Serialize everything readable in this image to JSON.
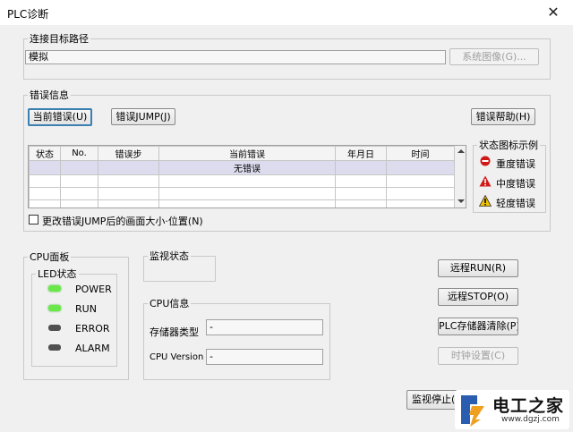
{
  "window": {
    "title": "PLC诊断",
    "close_glyph": "✕"
  },
  "connection": {
    "group_label": "连接目标路径",
    "target_value": "模拟",
    "system_image_button": "系统图像(G)..."
  },
  "error_info": {
    "group_label": "错误信息",
    "current_error_button": "当前错误(U)",
    "error_jump_button": "错误JUMP(J)",
    "error_help_button": "错误帮助(H)",
    "columns": [
      "状态",
      "No.",
      "错误步",
      "当前错误",
      "年月日",
      "时间"
    ],
    "rows": [
      [
        "",
        "",
        "",
        "无错误",
        "",
        ""
      ],
      [
        "",
        "",
        "",
        "",
        "",
        ""
      ],
      [
        "",
        "",
        "",
        "",
        "",
        ""
      ],
      [
        "",
        "",
        "",
        "",
        "",
        ""
      ]
    ],
    "resize_checkbox_label": "更改错误JUMP后的画面大小·位置(N)",
    "resize_checked": false
  },
  "legend": {
    "group_label": "状态图标示例",
    "items": [
      {
        "icon": "stop-circle-icon",
        "color": "#d01818",
        "label": "重度错误"
      },
      {
        "icon": "warning-triangle-icon",
        "color": "#d01818",
        "label": "中度错误"
      },
      {
        "icon": "warning-triangle-icon",
        "color": "#f2c200",
        "label": "轻度错误"
      }
    ]
  },
  "cpu_panel": {
    "group_label": "CPU面板",
    "led_group_label": "LED状态",
    "leds": [
      {
        "label": "POWER",
        "state": "on"
      },
      {
        "label": "RUN",
        "state": "on"
      },
      {
        "label": "ERROR",
        "state": "off"
      },
      {
        "label": "ALARM",
        "state": "off"
      }
    ]
  },
  "monitor_status": {
    "group_label": "监视状态"
  },
  "cpu_info": {
    "group_label": "CPU信息",
    "memory_type_label": "存储器类型",
    "memory_type_value": "-",
    "cpu_version_label": "CPU Version",
    "cpu_version_value": "-"
  },
  "actions": {
    "remote_run": "远程RUN(R)",
    "remote_stop": "远程STOP(O)",
    "plc_memory_clear": "PLC存储器清除(P)",
    "clock_setting": "时钟设置(C)",
    "monitor_stop": "监视停止("
  },
  "watermark": {
    "text": "电工之家",
    "url": "www.dgzj.com"
  },
  "colors": {
    "led_on": "#6ae84a",
    "led_off": "#505050",
    "selected_row": "#dcdcee",
    "default_button_border": "#3c7fb1"
  }
}
